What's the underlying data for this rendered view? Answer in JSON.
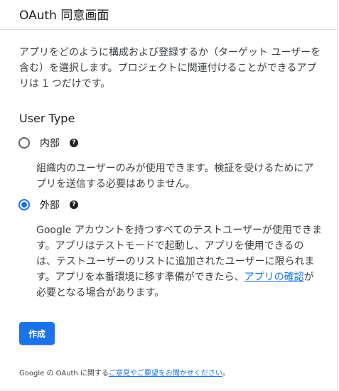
{
  "header": {
    "title": "OAuth 同意画面"
  },
  "intro": {
    "text": "アプリをどのように構成および登録するか（ターゲット ユーザーを含む）を選択します。プロジェクトに関連付けることができるアプリは 1 つだけです。"
  },
  "user_type": {
    "title": "User Type",
    "options": [
      {
        "label": "内部",
        "checked": false,
        "help_icon": "help-circle-icon",
        "description": "組織内のユーザーのみが使用できます。検証を受けるためにアプリを送信する必要はありません。"
      },
      {
        "label": "外部",
        "checked": true,
        "help_icon": "help-circle-icon",
        "description": "Google アカウントを持つすべてのテストユーザーが使用できます。アプリはテストモードで起動し、アプリを使用できるのは、テストユーザーのリストに追加されたユーザーに限られます。アプリを本番環境に移す準備ができたら、",
        "link": "アプリの確認",
        "description_after_link": "が必要となる場合があります。"
      }
    ]
  },
  "actions": {
    "create_label": "作成"
  },
  "footer": {
    "prefix": "Google の OAuth に関する",
    "link": "ご意見やご要望をお聞かせください",
    "suffix": "。"
  },
  "colors": {
    "accent": "#1a73e8",
    "border": "#dadce0",
    "text": "#202124"
  }
}
